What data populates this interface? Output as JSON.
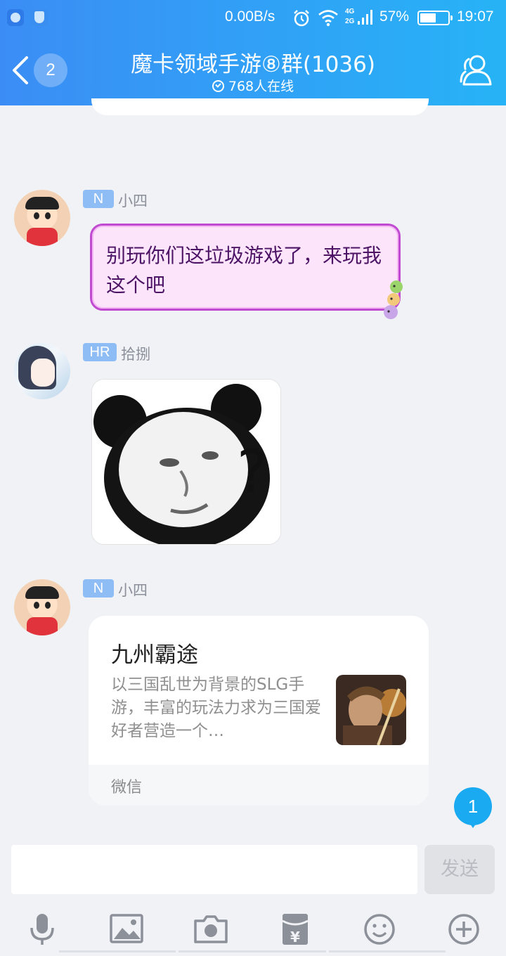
{
  "status_bar": {
    "network_speed": "0.00B/s",
    "signal_4g": "4G",
    "signal_2g": "2G",
    "battery_percent": "57%",
    "battery_level": 0.57,
    "time": "19:07"
  },
  "header": {
    "back_badge": "2",
    "title": "魔卡领域手游⑧群(1036)",
    "online": "768人在线",
    "accent_from": "#3b8df5",
    "accent_to": "#27b3f6"
  },
  "messages": [
    {
      "tag": "N",
      "sender": "小四",
      "text": "别玩你们这垃圾游戏了，来玩我这个吧"
    },
    {
      "tag": "HR",
      "sender": "拾捌",
      "sticker": "?"
    },
    {
      "tag": "N",
      "sender": "小四",
      "card": {
        "title": "九州霸途",
        "description": "以三国乱世为背景的SLG手游，丰富的玩法力求为三国爱好者营造一个…",
        "source": "微信"
      }
    }
  ],
  "unread_count": "1",
  "input": {
    "placeholder": "",
    "send_label": "发送"
  },
  "toolbar": [
    "microphone-icon",
    "image-icon",
    "camera-icon",
    "red-packet-icon",
    "emoji-icon",
    "plus-icon"
  ]
}
